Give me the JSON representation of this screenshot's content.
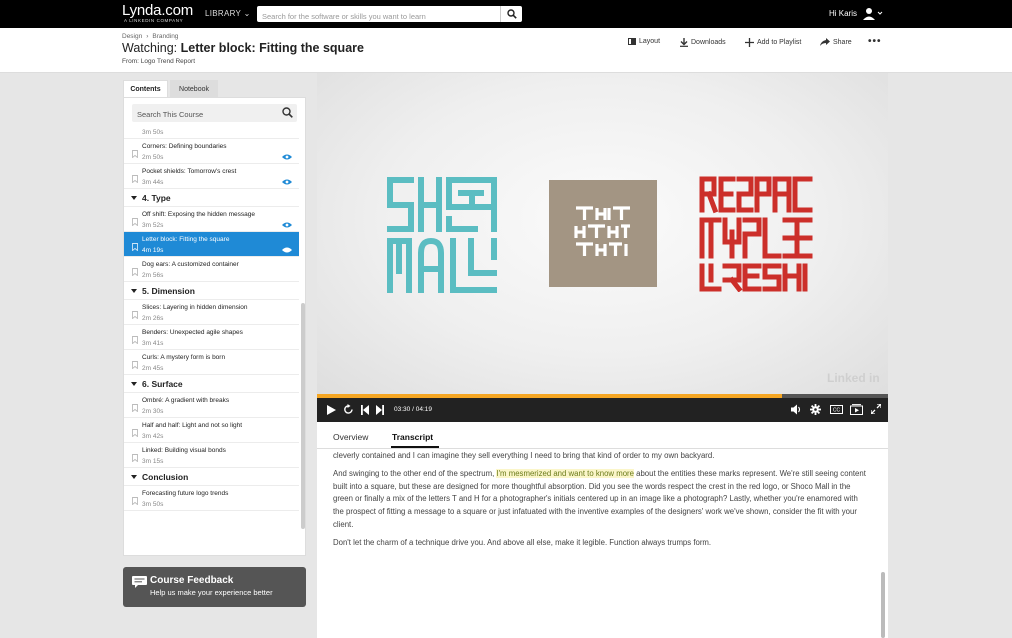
{
  "navbar": {
    "logo_text": "Lynda.com",
    "logo_sub": "A LINKEDIN COMPANY",
    "library_label": "LIBRARY",
    "search_placeholder": "Search for the software or skills you want to learn",
    "greeting": "Hi Karis"
  },
  "header": {
    "breadcrumb": [
      "Design",
      "Branding"
    ],
    "title_prefix": "Watching:",
    "title": "Letter block: Fitting the square",
    "from_label": "From:",
    "from_course": "Logo Trend Report",
    "actions": {
      "layout": "Layout",
      "downloads": "Downloads",
      "add_playlist": "Add to Playlist",
      "share": "Share",
      "more": "•••"
    }
  },
  "sidebar": {
    "tabs": [
      "Contents",
      "Notebook"
    ],
    "search_placeholder": "Search This Course",
    "entries": [
      {
        "kind": "duration-only",
        "duration": "3m 50s"
      },
      {
        "kind": "item",
        "title": "Corners: Defining boundaries",
        "duration": "2m 50s",
        "viewed": true
      },
      {
        "kind": "item",
        "title": "Pocket shields: Tomorrow's crest",
        "duration": "3m 44s",
        "viewed": true
      },
      {
        "kind": "section",
        "title": "4. Type"
      },
      {
        "kind": "item",
        "title": "Off shift: Exposing the hidden message",
        "duration": "3m 52s",
        "viewed": true
      },
      {
        "kind": "item",
        "title": "Letter block: Fitting the square",
        "duration": "4m 19s",
        "viewed": true,
        "active": true
      },
      {
        "kind": "item",
        "title": "Dog ears: A customized container",
        "duration": "2m 56s",
        "viewed": false
      },
      {
        "kind": "section",
        "title": "5. Dimension"
      },
      {
        "kind": "item",
        "title": "Slices: Layering in hidden dimension",
        "duration": "2m 26s",
        "viewed": false
      },
      {
        "kind": "item",
        "title": "Benders: Unexpected agile shapes",
        "duration": "3m 41s",
        "viewed": false
      },
      {
        "kind": "item",
        "title": "Curls: A mystery form is born",
        "duration": "2m 45s",
        "viewed": false
      },
      {
        "kind": "section",
        "title": "6. Surface"
      },
      {
        "kind": "item",
        "title": "Ombré: A gradient with breaks",
        "duration": "2m 30s",
        "viewed": false
      },
      {
        "kind": "item",
        "title": "Half and half: Light and not so light",
        "duration": "3m 42s",
        "viewed": false
      },
      {
        "kind": "item",
        "title": "Linked: Building visual bonds",
        "duration": "3m 15s",
        "viewed": false
      },
      {
        "kind": "section",
        "title": "Conclusion"
      },
      {
        "kind": "item",
        "title": "Forecasting future logo trends",
        "duration": "3m 50s",
        "viewed": false
      }
    ]
  },
  "feedback": {
    "title": "Course Feedback",
    "subtitle": "Help us make your experience better"
  },
  "player": {
    "current_time": "03:30",
    "separator": "/",
    "total_time": "04:19",
    "progress_fraction": 0.815,
    "accent_color": "#f5a623",
    "watermark": "Linked in",
    "controls": [
      "play-icon",
      "replay-icon",
      "previous-icon",
      "next-icon",
      "volume-icon",
      "settings-icon",
      "captions-icon",
      "theater-icon",
      "fullscreen-icon"
    ]
  },
  "lower": {
    "tabs": [
      "Overview",
      "Transcript"
    ],
    "active_tab": "Transcript",
    "paragraph1": "cleverly contained and I can imagine they sell everything I need to bring that kind of order to my own backyard.",
    "p2_before": "And swinging to the other end of the spectrum, ",
    "p2_highlight": "I'm mesmerized and want to know more",
    "p2_after": " about the entities these marks represent. We're still seeing content built into a square, but these are designed for more thoughtful absorption. Did you see the words respect the crest in the red logo, or Shoco Mall in the green or finally a mix of the letters T and H for a photographer's initials centered up in an image like a photograph? Lastly, whether you're enamored with the prospect of fitting a message to a square or just infatuated with the inventive examples of the designers' work we've shown, consider the fit with your client.",
    "paragraph3": "Don't let the charm of a technique drive you. And above all else, make it legible. Function always trumps form."
  }
}
